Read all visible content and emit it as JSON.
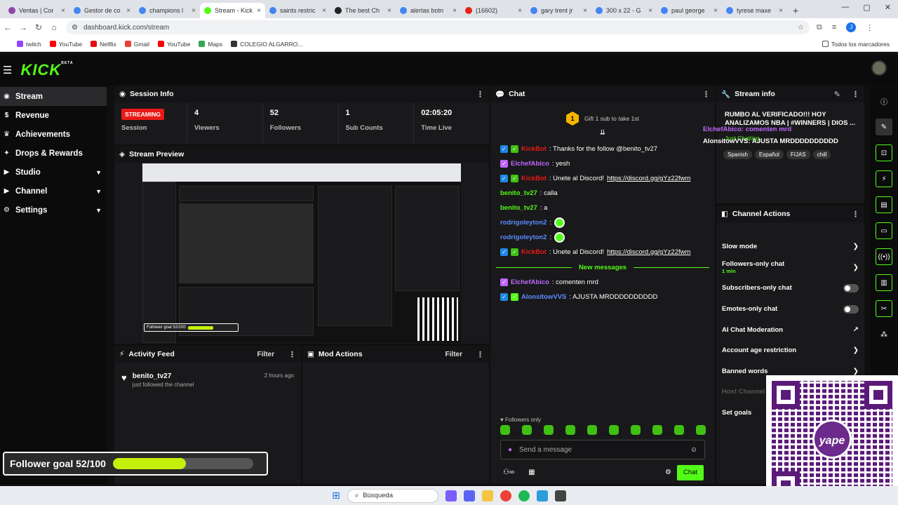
{
  "browser": {
    "tabs": [
      {
        "label": "Ventas | Cor",
        "color": "#8e44ad"
      },
      {
        "label": "Gestor de co",
        "color": "#4285f4"
      },
      {
        "label": "champions l",
        "color": "#4285f4"
      },
      {
        "label": "Stream - Kick",
        "color": "#53fc18",
        "active": true
      },
      {
        "label": "saints restric",
        "color": "#4285f4"
      },
      {
        "label": "The best Ch",
        "color": "#222"
      },
      {
        "label": "alertas botn",
        "color": "#4285f4"
      },
      {
        "label": "(16602)",
        "color": "#e62117"
      },
      {
        "label": "gary trent jr",
        "color": "#4285f4"
      },
      {
        "label": "300 x 22 - G",
        "color": "#4285f4"
      },
      {
        "label": "paul george",
        "color": "#4285f4"
      },
      {
        "label": "tyrese maxe",
        "color": "#4285f4"
      }
    ],
    "url": "dashboard.kick.com/stream",
    "profile_initial": "J",
    "bookmarks": [
      "twitch",
      "YouTube",
      "Netflix",
      "Gmail",
      "YouTube",
      "Maps",
      "COLEGIO ALGARRO..."
    ],
    "bookmarks_right": "Todos los marcadores"
  },
  "sidebar": {
    "items": [
      {
        "label": "Stream",
        "icon": "broadcast-icon",
        "active": true
      },
      {
        "label": "Revenue",
        "icon": "dollar-icon"
      },
      {
        "label": "Achievements",
        "icon": "trophy-icon"
      },
      {
        "label": "Drops & Rewards",
        "icon": "gift-icon"
      },
      {
        "label": "Studio",
        "icon": "studio-icon",
        "expand": true
      },
      {
        "label": "Channel",
        "icon": "channel-icon",
        "expand": true
      },
      {
        "label": "Settings",
        "icon": "gear-icon",
        "expand": true
      }
    ]
  },
  "session": {
    "title": "Session Info",
    "status": "STREAMING",
    "status_label": "Session",
    "stats": [
      {
        "value": "4",
        "label": "Viewers"
      },
      {
        "value": "52",
        "label": "Followers"
      },
      {
        "value": "1",
        "label": "Sub Counts"
      },
      {
        "value": "02:05:20",
        "label": "Time Live"
      }
    ]
  },
  "preview": {
    "title": "Stream Preview",
    "goal_text": "Follower goal 52/100"
  },
  "activity": {
    "title": "Activity Feed",
    "filter": "Filter",
    "items": [
      {
        "user": "benito_tv27",
        "action": "just followed the channel",
        "time": "2 hours ago"
      }
    ]
  },
  "mod": {
    "title": "Mod Actions",
    "filter": "Filter"
  },
  "chat": {
    "title": "Chat",
    "gift_text": "Gift 1 sub to take 1st",
    "gift_count": "1",
    "messages": [
      {
        "user": "KickBot",
        "color": "#e91916",
        "badges": [
          "#1e88e5",
          "#3fc013"
        ],
        "text": ": Thanks for the follow @benito_tv27"
      },
      {
        "user": "ElchefAbico",
        "color": "#c066ff",
        "badges": [
          "#c066ff"
        ],
        "text": ": yesh"
      },
      {
        "user": "KickBot",
        "color": "#e91916",
        "badges": [
          "#1e88e5",
          "#3fc013"
        ],
        "text": ": Unete al Discord! ",
        "link": "https://discord.gg/gYz22fwm"
      },
      {
        "user": "benito_tv27",
        "color": "#53fc18",
        "badges": [],
        "text": ": calla"
      },
      {
        "user": "benito_tv27",
        "color": "#53fc18",
        "badges": [],
        "text": ": a"
      },
      {
        "user": "rodrigoleyton2",
        "color": "#5b8cff",
        "badges": [],
        "text": ":",
        "emote": true
      },
      {
        "user": "rodrigoleyton2",
        "color": "#5b8cff",
        "badges": [],
        "text": ":",
        "emote": true
      },
      {
        "user": "KickBot",
        "color": "#e91916",
        "badges": [
          "#1e88e5",
          "#3fc013"
        ],
        "text": ": Unete al Discord! ",
        "link": "https://discord.gg/gYz22fwm"
      }
    ],
    "new_messages": "New messages",
    "messages_after": [
      {
        "user": "ElchefAbico",
        "color": "#c066ff",
        "badges": [
          "#c066ff"
        ],
        "text": ": comenten mrd"
      },
      {
        "user": "AlonsitowVVS",
        "color": "#5b8cff",
        "badges": [
          "#1e88e5",
          "#53fc18"
        ],
        "text": ": AJUSTA MRDDDDDDDDDD"
      }
    ],
    "followers_only": "Followers only",
    "placeholder": "Send a message",
    "send_label": "Chat"
  },
  "stream_info": {
    "title": "Stream info",
    "stream_title": "RUMBO AL VERIFICADO!!! HOY ANALIZAMOS NBA | #WINNERS | DIOS ...",
    "category": "Just Chatting",
    "tags": [
      "Spanish",
      "Español",
      "FIJAS",
      "chill"
    ],
    "overlay_1": "ElchefAbico: comenten mrd",
    "overlay_2": "AlonsitowVVS: AJUSTA MRDDDDDDDDDD"
  },
  "channel_actions": {
    "title": "Channel Actions",
    "items": [
      {
        "label": "Slow mode",
        "kind": "arrow"
      },
      {
        "label": "Followers-only chat",
        "kind": "arrow",
        "sub": "1 min"
      },
      {
        "label": "Subscribers-only chat",
        "kind": "toggle"
      },
      {
        "label": "Emotes-only chat",
        "kind": "toggle"
      },
      {
        "label": "AI Chat Moderation",
        "kind": "external"
      },
      {
        "label": "Account age restriction",
        "kind": "arrow"
      },
      {
        "label": "Banned words",
        "kind": "arrow"
      },
      {
        "label": "Host Channel",
        "kind": "disabled"
      },
      {
        "label": "Set goals",
        "kind": "none"
      }
    ]
  },
  "overlay": {
    "goal_label": "Follower goal 52/100",
    "goal_fraction": 0.52,
    "qr_brand": "yape"
  },
  "taskbar": {
    "search": "Búsqueda"
  }
}
